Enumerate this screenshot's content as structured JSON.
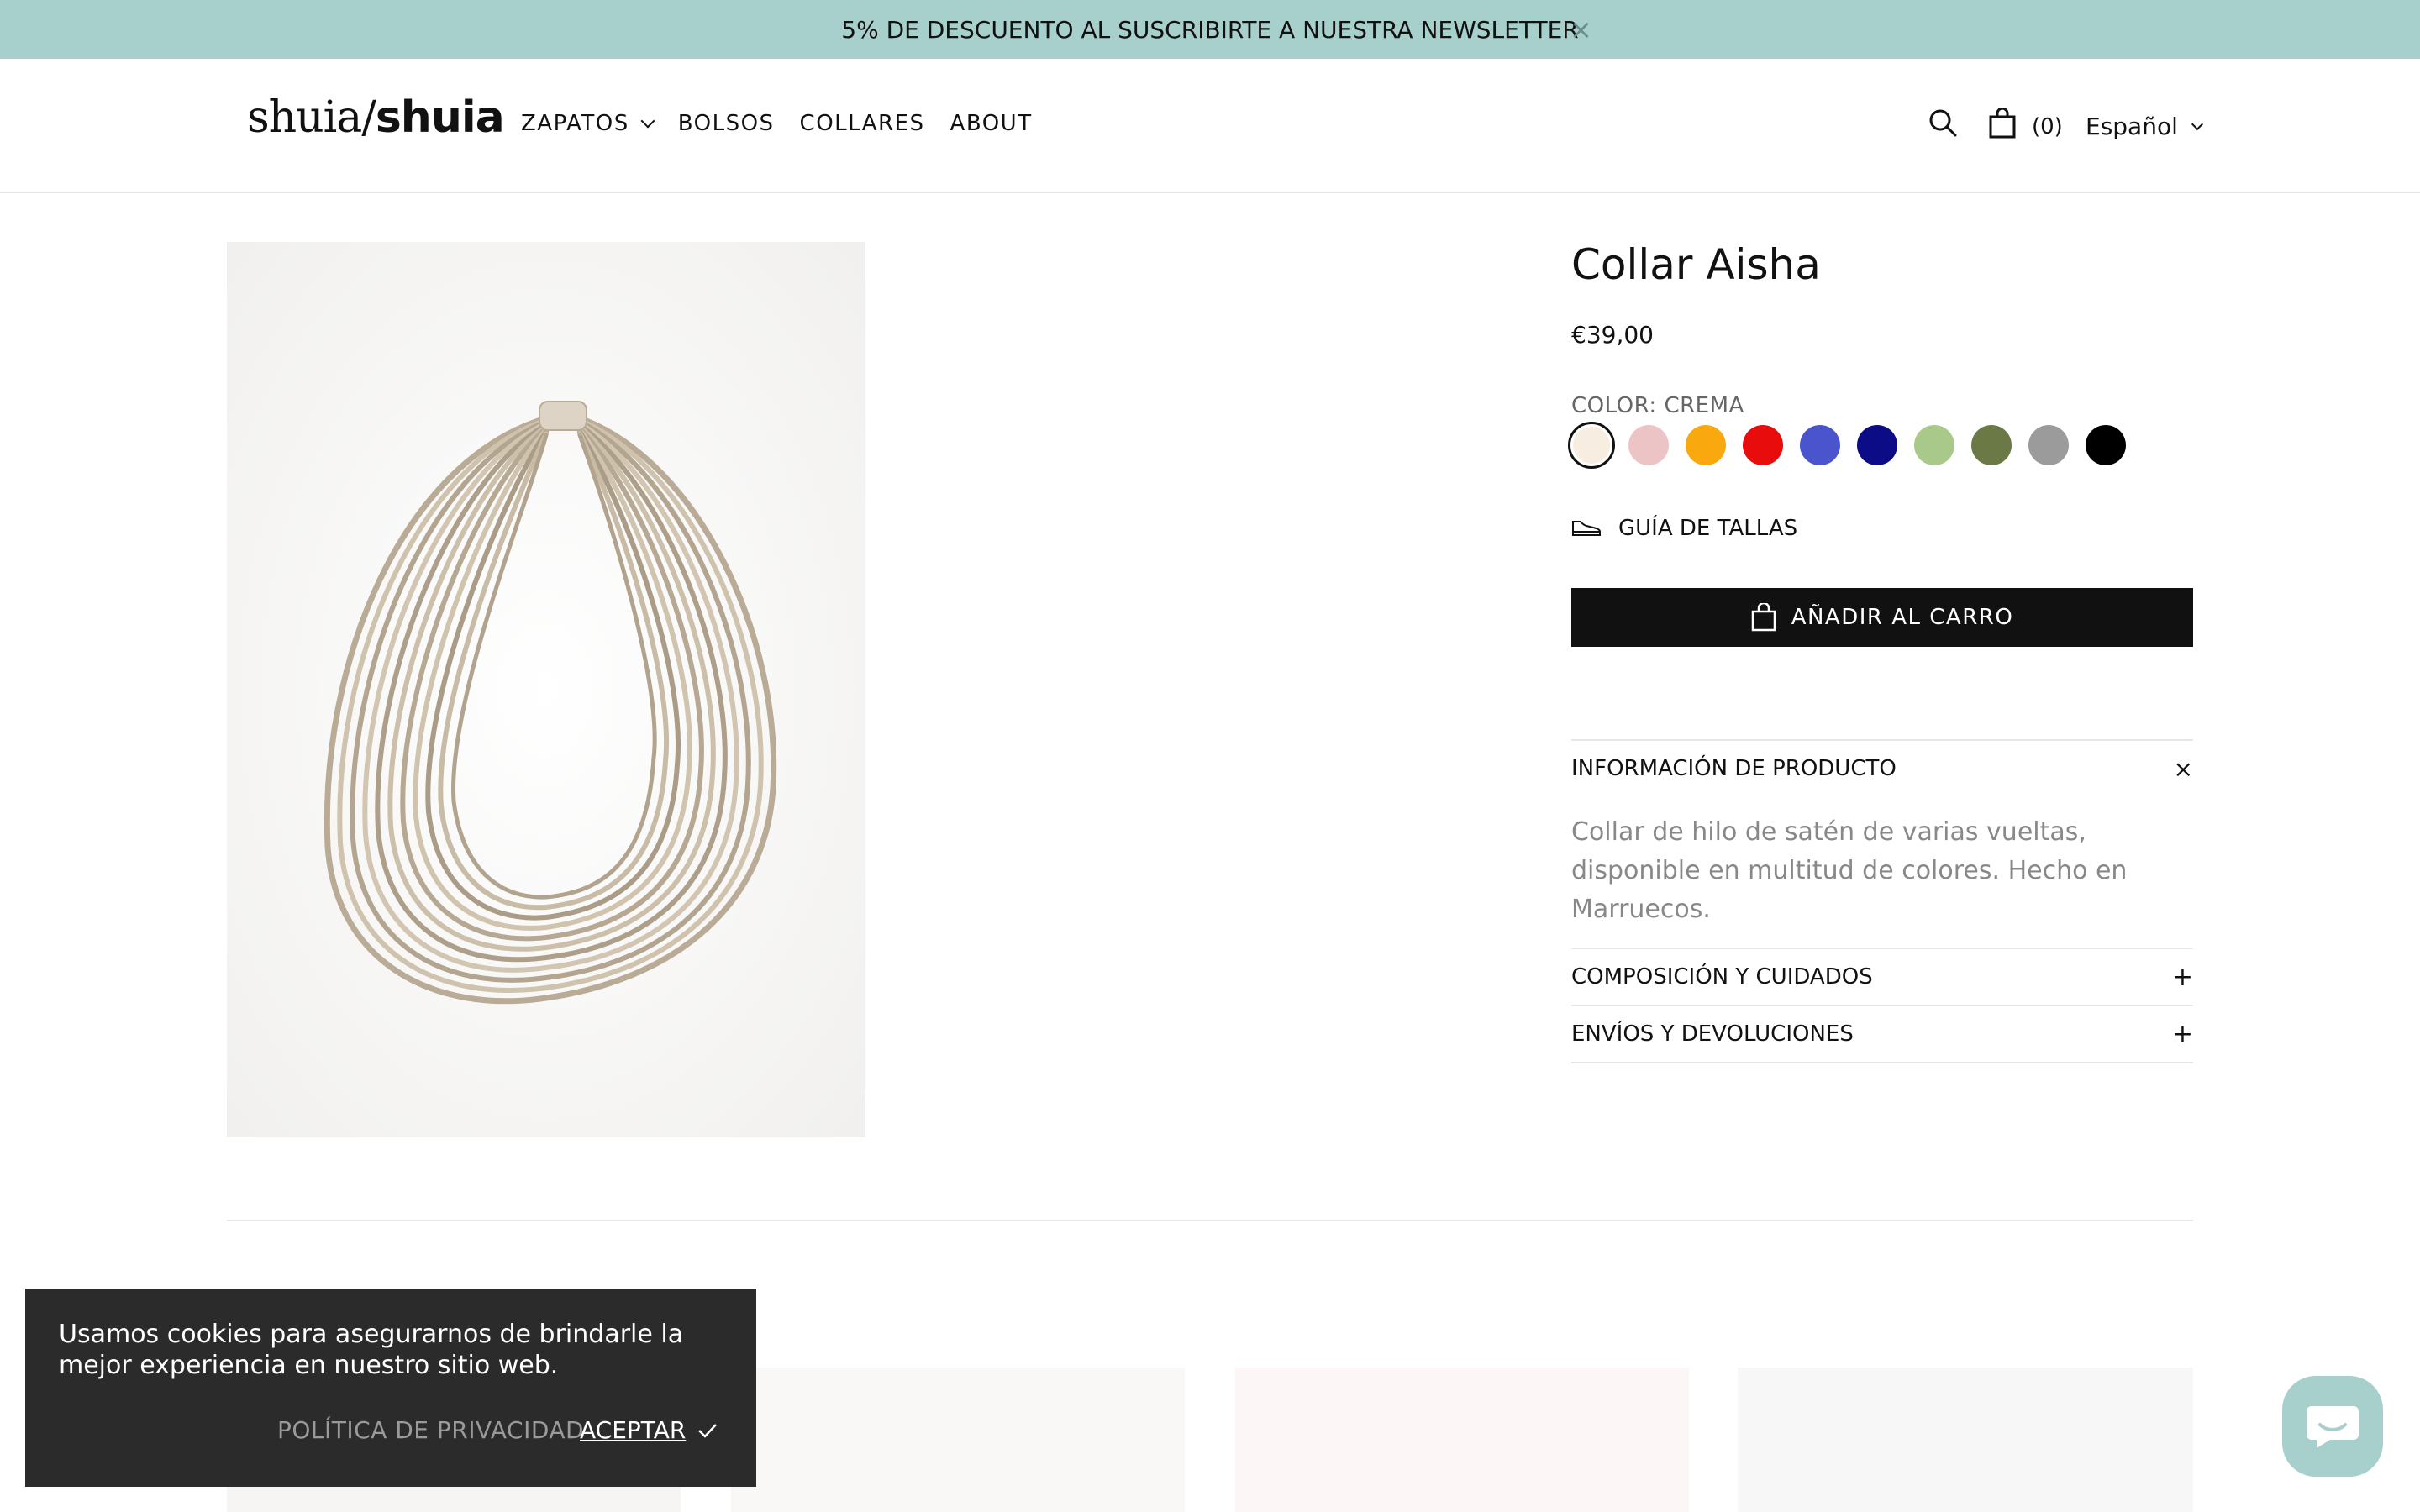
{
  "announcement": {
    "text": "5% DE DESCUENTO AL SUSCRIBIRTE A NUESTRA NEWSLETTER",
    "close": "×"
  },
  "header": {
    "logo": {
      "part1": "shuia",
      "slash": "/",
      "part2": "shuia"
    },
    "nav": [
      {
        "label": "ZAPATOS",
        "has_dropdown": true
      },
      {
        "label": "BOLSOS"
      },
      {
        "label": "COLLARES"
      },
      {
        "label": "ABOUT"
      }
    ],
    "cart_count": "(0)",
    "language": "Español"
  },
  "product": {
    "title": "Collar Aisha",
    "price": "€39,00",
    "color_label": "COLOR:",
    "color_value": "CREMA",
    "swatches": [
      "#f7ede0",
      "#ecc4c6",
      "#f9a80d",
      "#e80c0c",
      "#4a55cd",
      "#0c0c87",
      "#a8c98a",
      "#6b7947",
      "#9b9b9b",
      "#000000"
    ],
    "size_guide": "GUÍA DE TALLAS",
    "add_to_cart": "AÑADIR AL CARRO",
    "accordion": [
      {
        "title": "INFORMACIÓN DE PRODUCTO",
        "icon": "×",
        "body": "Collar de hilo de satén de varias vueltas, disponible en multitud de colores. Hecho en Marruecos."
      },
      {
        "title": "COMPOSICIÓN Y CUIDADOS",
        "icon": "+"
      },
      {
        "title": "ENVÍOS Y DEVOLUCIONES",
        "icon": "+"
      }
    ]
  },
  "cookie": {
    "text": "Usamos cookies para asegurarnos de brindarle la mejor experiencia en nuestro sitio web.",
    "privacy": "POLÍTICA DE PRIVACIDAD",
    "accept": "ACEPTAR"
  },
  "colors": {
    "announce_bg": "#a7cfcb",
    "button_bg": "#111111",
    "cookie_bg": "#2b2b2b"
  }
}
